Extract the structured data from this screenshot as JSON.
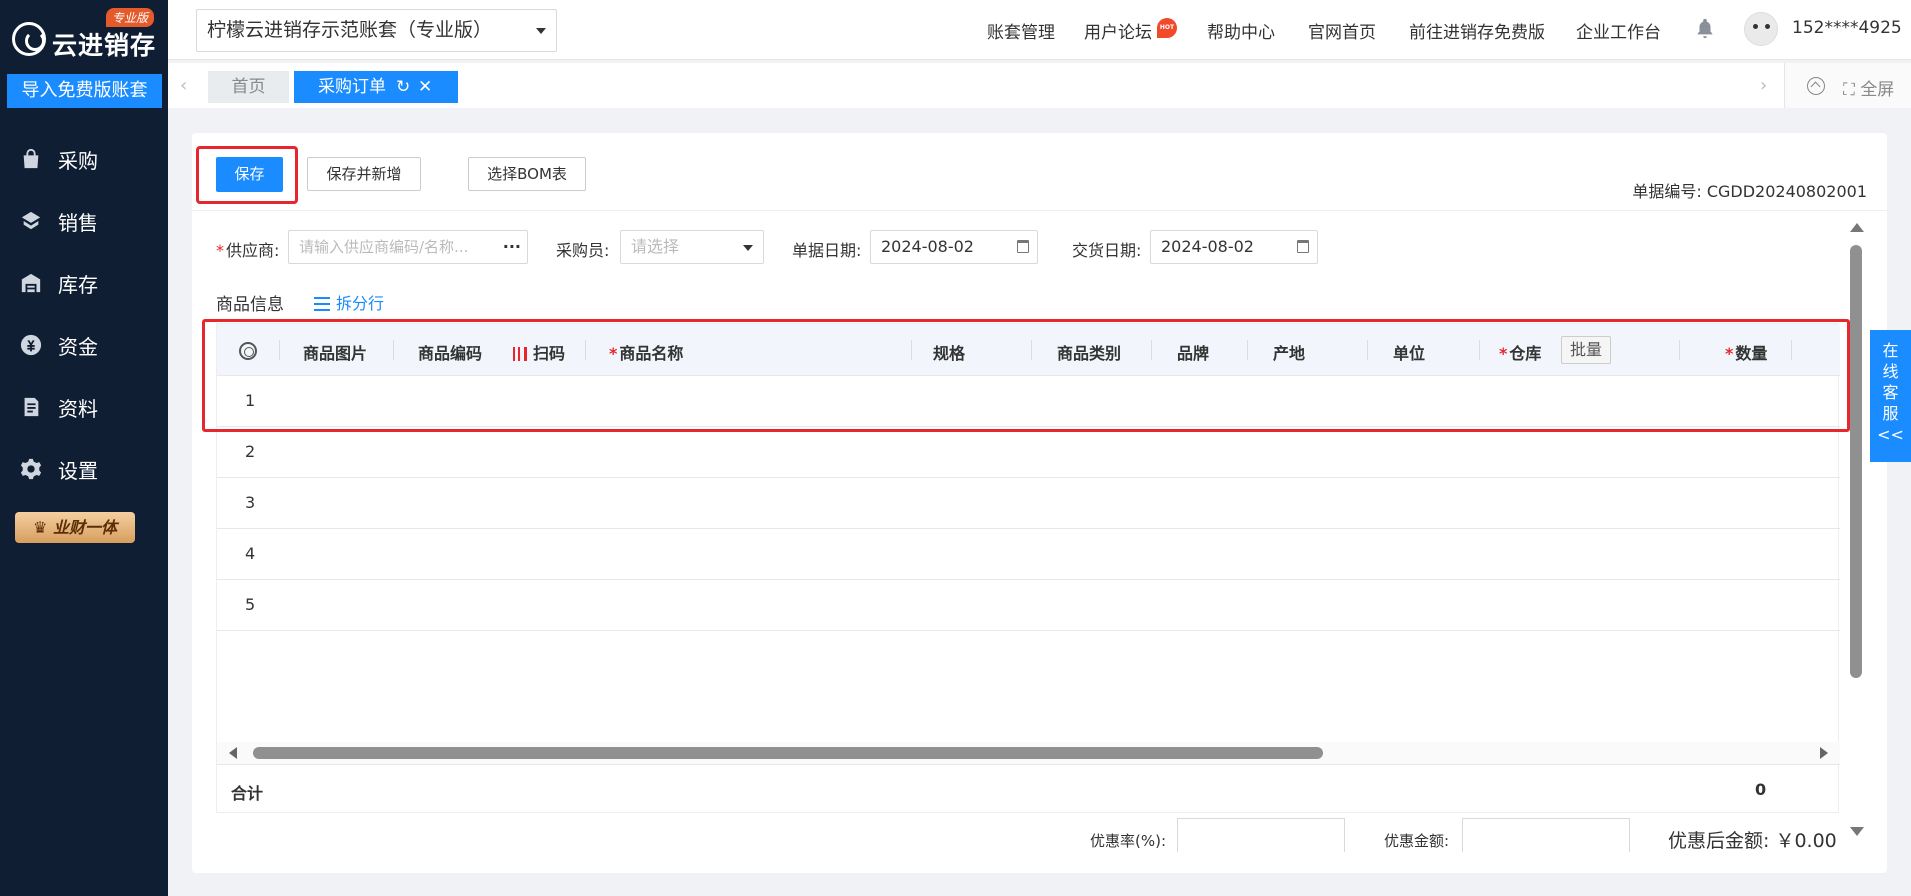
{
  "sidebar": {
    "brand_badge": "专业版",
    "brand_name": "云进销存",
    "import_label": "导入免费版账套",
    "items": [
      {
        "label": "采购",
        "icon": "bag-icon"
      },
      {
        "label": "销售",
        "icon": "sales-icon"
      },
      {
        "label": "库存",
        "icon": "warehouse-icon"
      },
      {
        "label": "资金",
        "icon": "yen-icon"
      },
      {
        "label": "资料",
        "icon": "document-icon"
      },
      {
        "label": "设置",
        "icon": "gear-icon"
      }
    ],
    "vip_label": "业财一体"
  },
  "header": {
    "account_name": "柠檬云进销存示范账套（专业版）",
    "nav": [
      "账套管理",
      "用户论坛",
      "帮助中心",
      "官网首页",
      "前往进销存免费版",
      "企业工作台"
    ],
    "hot_badge": "HOT",
    "user_phone": "152****4925"
  },
  "tabs": {
    "home": "首页",
    "active": "采购订单",
    "fullscreen": "全屏"
  },
  "toolbar": {
    "save_label": "保存",
    "save_new_label": "保存并新增",
    "bom_label": "选择BOM表",
    "doc_no_label": "单据编号:",
    "doc_no": "CGDD20240802001"
  },
  "form": {
    "supplier_label": "供应商:",
    "supplier_placeholder": "请输入供应商编码/名称...",
    "buyer_label": "采购员:",
    "buyer_placeholder": "请选择",
    "doc_date_label": "单据日期:",
    "doc_date": "2024-08-02",
    "delivery_date_label": "交货日期:",
    "delivery_date": "2024-08-02"
  },
  "goods": {
    "section_title": "商品信息",
    "split_label": "拆分行",
    "columns": [
      "商品图片",
      "商品编码",
      "扫码",
      "商品名称",
      "规格",
      "商品类别",
      "品牌",
      "产地",
      "单位",
      "仓库",
      "数量"
    ],
    "batch_label": "批量",
    "rows": [
      "1",
      "2",
      "3",
      "4",
      "5"
    ],
    "total_label": "合计",
    "total_value": "0"
  },
  "footer": {
    "discount_rate_label": "优惠率(%):",
    "discount_amount_label": "优惠金额:",
    "final_amount_label": "优惠后金额:",
    "final_amount": "￥0.00"
  },
  "service": {
    "label": "在线客服",
    "arrow": "<<"
  },
  "colors": {
    "sidebar_bg": "#0f1e33",
    "primary": "#1a8cff",
    "highlight": "#e6282e"
  }
}
